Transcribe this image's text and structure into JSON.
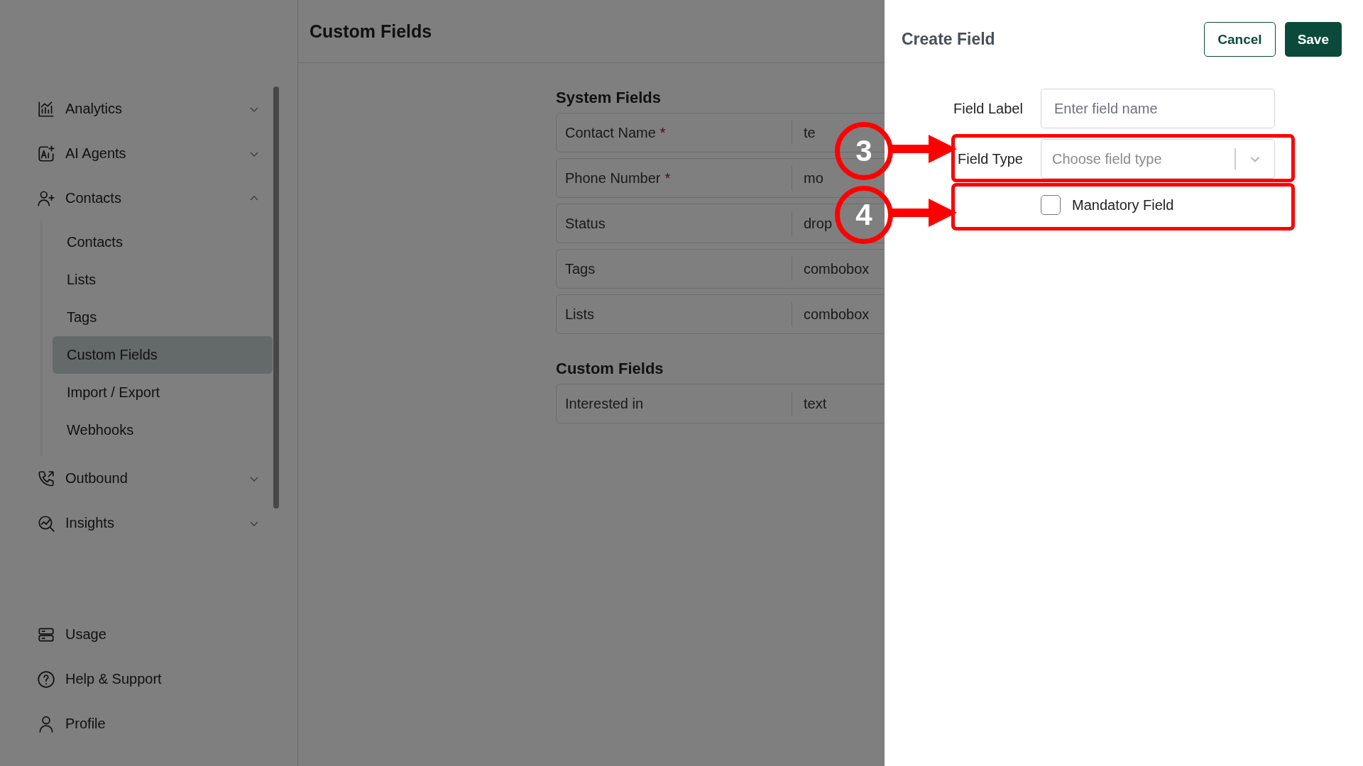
{
  "page": {
    "title": "Custom Fields"
  },
  "sidebar": {
    "items": [
      {
        "label": "Analytics",
        "expanded": false
      },
      {
        "label": "AI Agents",
        "expanded": false
      },
      {
        "label": "Contacts",
        "expanded": true,
        "children": [
          {
            "label": "Contacts",
            "selected": false
          },
          {
            "label": "Lists",
            "selected": false
          },
          {
            "label": "Tags",
            "selected": false
          },
          {
            "label": "Custom Fields",
            "selected": true
          },
          {
            "label": "Import / Export",
            "selected": false
          },
          {
            "label": "Webhooks",
            "selected": false
          }
        ]
      },
      {
        "label": "Outbound",
        "expanded": false
      },
      {
        "label": "Insights",
        "expanded": false
      }
    ],
    "footer": [
      {
        "label": "Usage"
      },
      {
        "label": "Help & Support"
      },
      {
        "label": "Profile"
      }
    ]
  },
  "sections": [
    {
      "heading": "System Fields",
      "rows": [
        {
          "name": "Contact Name",
          "required_mark": "*",
          "type": "te"
        },
        {
          "name": "Phone Number",
          "required_mark": "*",
          "type": "mo"
        },
        {
          "name": "Status",
          "type": "drop"
        },
        {
          "name": "Tags",
          "type": "combobox"
        },
        {
          "name": "Lists",
          "type": "combobox"
        }
      ]
    },
    {
      "heading": "Custom Fields",
      "rows": [
        {
          "name": "Interested in",
          "type": "text"
        }
      ]
    }
  ],
  "panel": {
    "title": "Create Field",
    "buttons": [
      {
        "label": "Cancel",
        "kind": "secondary"
      },
      {
        "label": "Save",
        "kind": "primary"
      }
    ],
    "field_label": {
      "label": "Field Label",
      "placeholder": "Enter field name"
    },
    "field_type": {
      "label": "Field Type",
      "placeholder": "Choose field type"
    },
    "mandatory": {
      "label": "Mandatory Field",
      "checked": false
    }
  },
  "annotations": [
    {
      "number": "3"
    },
    {
      "number": "4"
    }
  ]
}
